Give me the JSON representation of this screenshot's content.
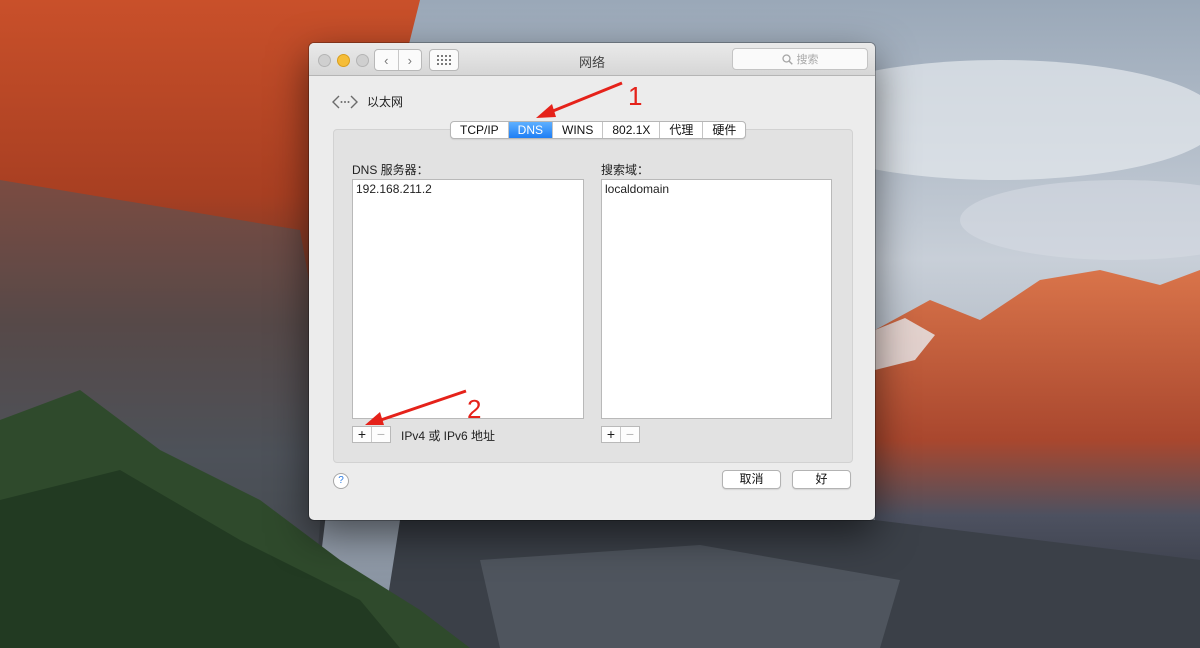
{
  "window": {
    "title": "网络",
    "search_placeholder": "搜索",
    "nav_back": "‹",
    "nav_forward": "›"
  },
  "interface": {
    "label": "以太网"
  },
  "tabs": [
    {
      "label": "TCP/IP",
      "active": false
    },
    {
      "label": "DNS",
      "active": true
    },
    {
      "label": "WINS",
      "active": false
    },
    {
      "label": "802.1X",
      "active": false
    },
    {
      "label": "代理",
      "active": false
    },
    {
      "label": "硬件",
      "active": false
    }
  ],
  "dns": {
    "label": "DNS 服务器：",
    "entries": [
      "192.168.211.2"
    ],
    "add": "+",
    "remove": "−",
    "hint": "IPv4 或 IPv6 地址"
  },
  "search_domains": {
    "label": "搜索域：",
    "entries": [
      "localdomain"
    ],
    "add": "+",
    "remove": "−"
  },
  "footer": {
    "help": "?",
    "cancel": "取消",
    "ok": "好"
  },
  "annotations": [
    {
      "number": "1",
      "color": "#e5221a"
    },
    {
      "number": "2",
      "color": "#e5221a"
    }
  ]
}
